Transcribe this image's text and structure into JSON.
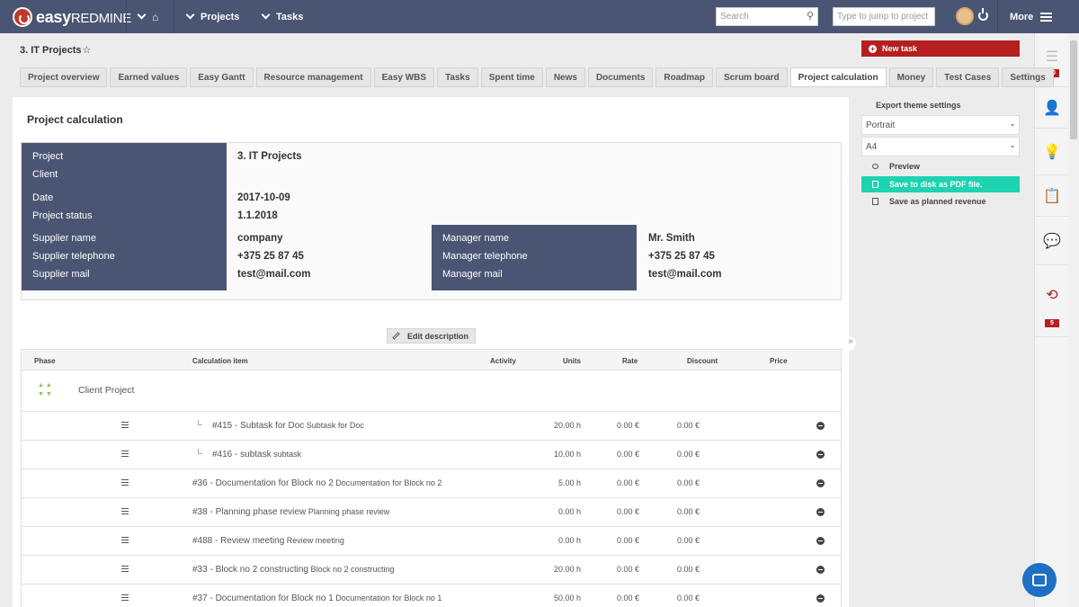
{
  "topbar": {
    "logo_text": "easy",
    "logo_text2": "REDMINE",
    "home_icon": "home-icon",
    "projects_label": "Projects",
    "tasks_label": "Tasks",
    "search_placeholder": "Search",
    "jump_placeholder": "Type to jump to project",
    "more_label": "More"
  },
  "page": {
    "project_title": "3. IT Projects",
    "new_task_label": "New task"
  },
  "tabs": [
    "Project overview",
    "Earned values",
    "Easy Gantt",
    "Resource management",
    "Easy WBS",
    "Tasks",
    "Spent time",
    "News",
    "Documents",
    "Roadmap",
    "Scrum board",
    "Project calculation",
    "Money",
    "Test Cases",
    "Settings"
  ],
  "active_tab": "Project calculation",
  "panel": {
    "title": "Project calculation",
    "labels": {
      "project": "Project",
      "client": "Client",
      "date": "Date",
      "project_status": "Project status",
      "supplier_name": "Supplier name",
      "supplier_telephone": "Supplier telephone",
      "supplier_mail": "Supplier mail",
      "manager_name": "Manager name",
      "manager_telephone": "Manager telephone",
      "manager_mail": "Manager mail"
    },
    "values": {
      "project": "3. IT Projects",
      "client": "",
      "date": "2017-10-09",
      "project_status": "1.1.2018",
      "supplier_name": "company",
      "supplier_telephone": "+375 25 87 45",
      "supplier_mail": "test@mail.com",
      "manager_name": "Mr. Smith",
      "manager_telephone": "+375 25 87 45",
      "manager_mail": "test@mail.com"
    },
    "edit_description": "Edit description"
  },
  "grid": {
    "headers": [
      "Phase",
      "Calculation item",
      "Activity",
      "Units",
      "Rate",
      "Discount",
      "Price"
    ],
    "phase_name": "Client Project",
    "rows": [
      {
        "title": "#415 - Subtask for Doc",
        "sub": "Subtask for Doc",
        "units": "20.00 h",
        "rate": "0.00 €",
        "discount": "0.00 €",
        "nested": true
      },
      {
        "title": "#416 - subtask",
        "sub": "subtask",
        "units": "10.00 h",
        "rate": "0.00 €",
        "discount": "0.00 €",
        "nested": true
      },
      {
        "title": "#36 - Documentation for Block no 2",
        "sub": "Documentation for Block no 2",
        "units": "5.00 h",
        "rate": "0.00 €",
        "discount": "0.00 €",
        "nested": false
      },
      {
        "title": "#38 - Planning phase review",
        "sub": "Planning phase review",
        "units": "0.00 h",
        "rate": "0.00 €",
        "discount": "0.00 €",
        "nested": false
      },
      {
        "title": "#488 - Review meeting",
        "sub": "Review meeting",
        "units": "0.00 h",
        "rate": "0.00 €",
        "discount": "0.00 €",
        "nested": false
      },
      {
        "title": "#33 - Block no 2 constructing",
        "sub": "Block no 2 constructing",
        "units": "20.00 h",
        "rate": "0.00 €",
        "discount": "0.00 €",
        "nested": false
      },
      {
        "title": "#37 - Documentation for Block no 1",
        "sub": "Documentation for Block no 1",
        "units": "50.00 h",
        "rate": "0.00 €",
        "discount": "0.00 €",
        "nested": false
      }
    ]
  },
  "sidebar": {
    "export_title": "Export theme settings",
    "orientation": "Portrait",
    "paper": "A4",
    "preview": "Preview",
    "save_pdf": "Save to disk as PDF file.",
    "save_revenue": "Save as planned revenue"
  },
  "rail": {
    "badge1": "10",
    "badge2": "5"
  },
  "colors": {
    "topbar": "#4a5573",
    "accent_red": "#b51f1f",
    "accent_green": "#1dd3b0",
    "label_column": "#4a5573"
  }
}
